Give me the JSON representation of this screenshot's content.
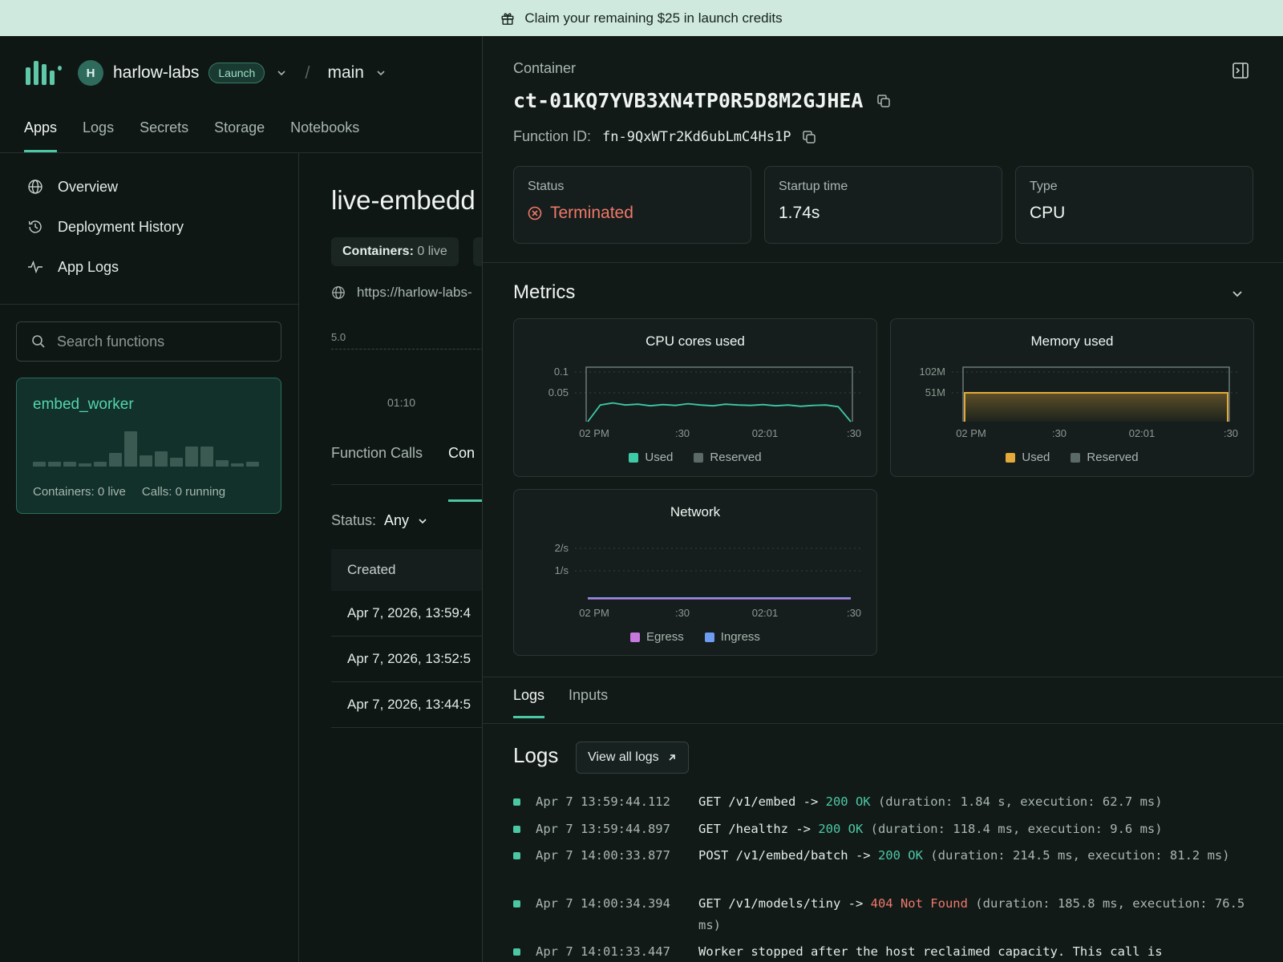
{
  "banner": {
    "text": "Claim your remaining $25 in launch credits",
    "icon": "gift-icon"
  },
  "header": {
    "avatar_initial": "H",
    "workspace": "harlow-labs",
    "plan_badge": "Launch",
    "separator": "/",
    "environment": "main"
  },
  "nav_tabs": [
    {
      "label": "Apps",
      "active": true
    },
    {
      "label": "Logs"
    },
    {
      "label": "Secrets"
    },
    {
      "label": "Storage"
    },
    {
      "label": "Notebooks"
    }
  ],
  "sidebar": {
    "items": [
      {
        "label": "Overview",
        "icon": "globe-icon"
      },
      {
        "label": "Deployment History",
        "icon": "history-icon"
      },
      {
        "label": "App Logs",
        "icon": "pulse-icon"
      }
    ],
    "search_placeholder": "Search functions",
    "function_card": {
      "name": "embed_worker",
      "containers": "Containers: 0 live",
      "calls": "Calls: 0 running",
      "activity": [
        1,
        1,
        1,
        0.5,
        1,
        3,
        8,
        2.5,
        3.5,
        2,
        4.5,
        4.5,
        1.5,
        0.5,
        1
      ]
    }
  },
  "main": {
    "app_title": "live-embedd",
    "containers_label": "Containers:",
    "containers_value": "0 live",
    "url": "https://harlow-labs-",
    "mini_chart_ymax": "5.0",
    "mini_chart_x": "01:10",
    "tabs": [
      "Function Calls",
      "Con"
    ],
    "status_filter_label": "Status:",
    "status_filter_value": "Any",
    "table_header": "Created",
    "rows": [
      "Apr 7, 2026, 13:59:4",
      "Apr 7, 2026, 13:52:5",
      "Apr 7, 2026, 13:44:5"
    ]
  },
  "panel": {
    "label": "Container",
    "container_id": "ct-01KQ7YVB3XN4TP0R5D8M2GJHEA",
    "function_id_label": "Function ID:",
    "function_id": "fn-9QxWTr2Kd6ubLmC4Hs1P",
    "stats": [
      {
        "label": "Status",
        "value": "Terminated"
      },
      {
        "label": "Startup time",
        "value": "1.74s"
      },
      {
        "label": "Type",
        "value": "CPU"
      }
    ],
    "metrics_title": "Metrics",
    "log_tabs": [
      "Logs",
      "Inputs"
    ],
    "logs_title": "Logs",
    "view_all_logs": "View all logs",
    "logs": [
      {
        "ts": "Apr 7 13:59:44.112",
        "pre": "GET /v1/embed -> ",
        "code": "200 OK",
        "code_class": "ok",
        "post": " (duration: 1.84 s, execution: 62.7 ms)"
      },
      {
        "ts": "Apr 7 13:59:44.897",
        "pre": "GET /healthz -> ",
        "code": "200 OK",
        "code_class": "ok",
        "post": " (duration: 118.4 ms, execution: 9.6 ms)"
      },
      {
        "ts": "Apr 7 14:00:33.877",
        "pre": "POST /v1/embed/batch -> ",
        "code": "200 OK",
        "code_class": "ok",
        "post": " (duration: 214.5 ms, execution: 81.2 ms)"
      },
      {
        "ts": "Apr 7 14:00:34.394",
        "pre": "GET /v1/models/tiny -> ",
        "code": "404 Not Found",
        "code_class": "err",
        "post": " (duration: 185.8 ms, execution: 76.5 ms)"
      },
      {
        "ts": "Apr 7 14:01:33.447",
        "pre": "Worker stopped after the host reclaimed capacity. This call is",
        "code": "",
        "code_class": "",
        "post": ""
      }
    ]
  },
  "chart_data": [
    {
      "type": "line",
      "title": "CPU cores used",
      "x": [
        "02 PM",
        ":30",
        "02:01",
        ":30"
      ],
      "yticks": [
        "0.1",
        "0.05"
      ],
      "ylim": [
        0,
        0.12
      ],
      "series": [
        {
          "name": "Used",
          "color": "#3ec9a7",
          "values": [
            0,
            0.04,
            0.045,
            0.04,
            0.042,
            0.038,
            0.041,
            0.039,
            0.043,
            0.04,
            0.038,
            0.042,
            0.04,
            0.039,
            0.041,
            0.038,
            0.04,
            0.037,
            0.039,
            0.04,
            0.036,
            0
          ]
        },
        {
          "name": "Reserved",
          "color": "#5b6a66",
          "values": [
            0.125,
            0.125
          ]
        }
      ]
    },
    {
      "type": "area",
      "title": "Memory used",
      "x": [
        "02 PM",
        ":30",
        "02:01",
        ":30"
      ],
      "yticks": [
        "102M",
        "51M"
      ],
      "ylim": [
        0,
        110
      ],
      "series": [
        {
          "name": "Used",
          "color": "#e3a93b",
          "values": [
            51,
            51
          ]
        },
        {
          "name": "Reserved",
          "color": "#5b6a66",
          "values": [
            102,
            102
          ]
        }
      ]
    },
    {
      "type": "line",
      "title": "Network",
      "x": [
        "02 PM",
        ":30",
        "02:01",
        ":30"
      ],
      "yticks": [
        "2/s",
        "1/s"
      ],
      "ylim": [
        0,
        2.6
      ],
      "series": [
        {
          "name": "Egress",
          "color": "#c678dd",
          "values": [
            0,
            0
          ]
        },
        {
          "name": "Ingress",
          "color": "#6d9cf0",
          "values": [
            0,
            0
          ]
        }
      ]
    }
  ]
}
